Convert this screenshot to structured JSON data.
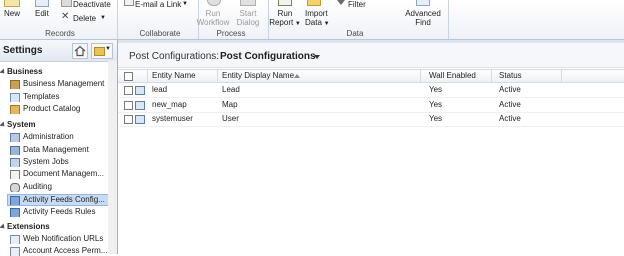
{
  "ribbon": {
    "records": {
      "new_label": "New",
      "edit_label": "Edit",
      "deactivate_label": "Deactivate",
      "delete_label": "Delete",
      "group_label": "Records"
    },
    "collaborate": {
      "email_link_label": "E-mail a Link",
      "group_label": "Collaborate"
    },
    "process": {
      "run_workflow_line1": "Run",
      "run_workflow_line2": "Workflow",
      "start_dialog_line1": "Start",
      "start_dialog_line2": "Dialog",
      "group_label": "Process"
    },
    "data": {
      "run_report_line1": "Run",
      "run_report_line2": "Report",
      "import_data_line1": "Import",
      "import_data_line2": "Data",
      "filter_label": "Filter",
      "advanced_find_line1": "Advanced",
      "advanced_find_line2": "Find",
      "group_label": "Data"
    }
  },
  "sidebar": {
    "title": "Settings",
    "sections": [
      {
        "label": "Business",
        "items": [
          {
            "label": "Business Management",
            "icon": "business-icon"
          },
          {
            "label": "Templates",
            "icon": "templates-icon"
          },
          {
            "label": "Product Catalog",
            "icon": "catalog-icon"
          }
        ]
      },
      {
        "label": "System",
        "items": [
          {
            "label": "Administration",
            "icon": "admin-icon"
          },
          {
            "label": "Data Management",
            "icon": "data-icon"
          },
          {
            "label": "System Jobs",
            "icon": "jobs-icon"
          },
          {
            "label": "Document Managem...",
            "icon": "document-icon"
          },
          {
            "label": "Auditing",
            "icon": "audit-icon"
          },
          {
            "label": "Activity Feeds Config...",
            "icon": "feeds-icon",
            "selected": true
          },
          {
            "label": "Activity Feeds Rules",
            "icon": "feeds-rules-icon"
          }
        ]
      },
      {
        "label": "Extensions",
        "items": [
          {
            "label": "Web Notification URLs",
            "icon": "web-icon"
          },
          {
            "label": "Account Access Perm...",
            "icon": "access-icon"
          }
        ]
      }
    ]
  },
  "main": {
    "view_label": "Post Configurations:",
    "view_name": "Post Configurations",
    "columns": [
      "Entity Name",
      "Entity Display Name",
      "Wall Enabled",
      "Status"
    ],
    "rows": [
      {
        "entity_name": "lead",
        "display_name": "Lead",
        "wall_enabled": "Yes",
        "status": "Active"
      },
      {
        "entity_name": "new_map",
        "display_name": "Map",
        "wall_enabled": "Yes",
        "status": "Active"
      },
      {
        "entity_name": "systemuser",
        "display_name": "User",
        "wall_enabled": "Yes",
        "status": "Active"
      }
    ]
  },
  "colors": {
    "ribbon_bg": "#eef2f8",
    "selected_bg": "#c7dcf4",
    "border": "#9fb0c8"
  }
}
